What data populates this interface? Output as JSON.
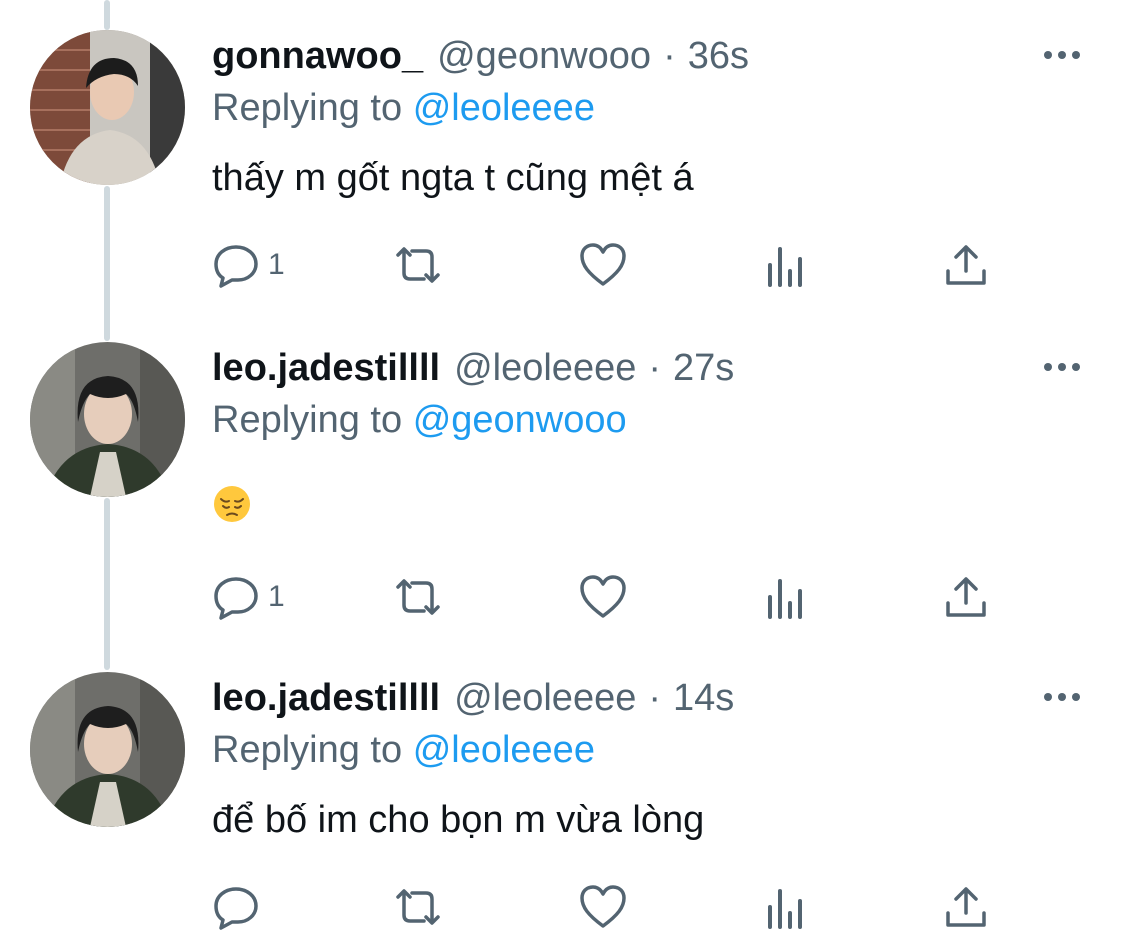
{
  "tweets": [
    {
      "display_name": "gonnawoo_",
      "handle": "@geonwooo",
      "separator": "·",
      "time": "36s",
      "replying_prefix": "Replying to",
      "replying_to": "@leoleeee",
      "text": "thấy m gốt ngta t cũng mệt á",
      "reply_count": "1",
      "avatar_icon": "profile-photo"
    },
    {
      "display_name": "leo.jadestillll",
      "handle": "@leoleeee",
      "separator": "·",
      "time": "27s",
      "replying_prefix": "Replying to",
      "replying_to": "@geonwooo",
      "text": "😔",
      "reply_count": "1",
      "avatar_icon": "profile-photo"
    },
    {
      "display_name": "leo.jadestillll",
      "handle": "@leoleeee",
      "separator": "·",
      "time": "14s",
      "replying_prefix": "Replying to",
      "replying_to": "@leoleeee",
      "text": "để bố im cho bọn m vừa lòng",
      "reply_count": "",
      "avatar_icon": "profile-photo"
    }
  ],
  "action_icons": [
    "reply-icon",
    "retweet-icon",
    "like-icon",
    "views-icon",
    "share-icon"
  ],
  "colors": {
    "text": "#0f1419",
    "secondary": "#536471",
    "mention": "#1d9bf0",
    "thread_line": "#cfd9de"
  }
}
